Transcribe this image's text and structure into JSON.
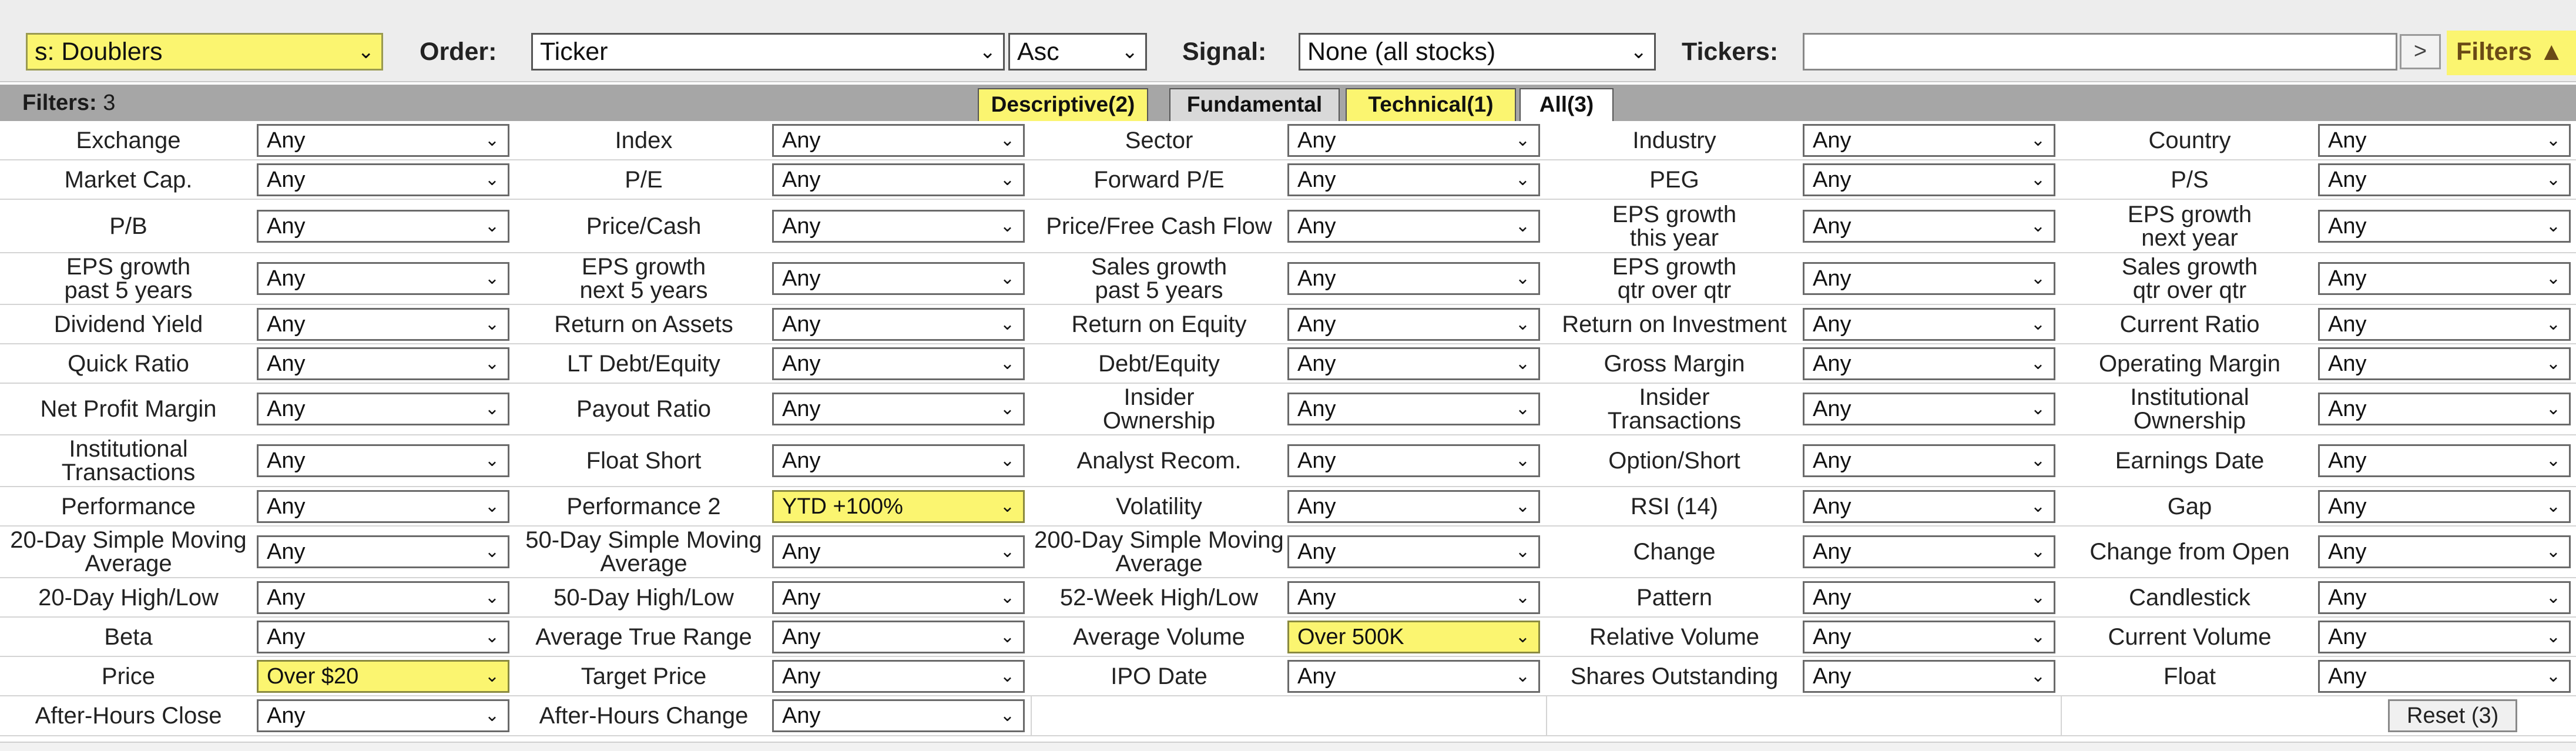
{
  "topbar": {
    "preset": "s: Doublers",
    "order_label": "Order:",
    "order_value": "Ticker",
    "order_dir": "Asc",
    "signal_label": "Signal:",
    "signal_value": "None (all stocks)",
    "tickers_label": "Tickers:",
    "tickers_value": "",
    "go_label": ">",
    "filters_toggle": "Filters ▲"
  },
  "filterbar": {
    "label": "Filters:",
    "count": "3",
    "tabs": [
      {
        "label": "Descriptive(2)",
        "state": "highlighted"
      },
      {
        "label": "Fundamental",
        "state": "normal"
      },
      {
        "label": "Technical(1)",
        "state": "highlighted"
      },
      {
        "label": "All(3)",
        "state": "active"
      }
    ]
  },
  "highlight_color": "#fbf570",
  "rows": [
    [
      {
        "label": "Exchange",
        "value": "Any"
      },
      {
        "label": "Index",
        "value": "Any"
      },
      {
        "label": "Sector",
        "value": "Any"
      },
      {
        "label": "Industry",
        "value": "Any"
      },
      {
        "label": "Country",
        "value": "Any"
      }
    ],
    [
      {
        "label": "Market Cap.",
        "value": "Any"
      },
      {
        "label": "P/E",
        "value": "Any"
      },
      {
        "label": "Forward P/E",
        "value": "Any"
      },
      {
        "label": "PEG",
        "value": "Any"
      },
      {
        "label": "P/S",
        "value": "Any"
      }
    ],
    [
      {
        "label": "P/B",
        "value": "Any"
      },
      {
        "label": "Price/Cash",
        "value": "Any"
      },
      {
        "label": "Price/Free Cash Flow",
        "value": "Any"
      },
      {
        "label": "EPS growth\nthis year",
        "value": "Any"
      },
      {
        "label": "EPS growth\nnext year",
        "value": "Any"
      }
    ],
    [
      {
        "label": "EPS growth\npast 5 years",
        "value": "Any"
      },
      {
        "label": "EPS growth\nnext 5 years",
        "value": "Any"
      },
      {
        "label": "Sales growth\npast 5 years",
        "value": "Any"
      },
      {
        "label": "EPS growth\nqtr over qtr",
        "value": "Any"
      },
      {
        "label": "Sales growth\nqtr over qtr",
        "value": "Any"
      }
    ],
    [
      {
        "label": "Dividend Yield",
        "value": "Any"
      },
      {
        "label": "Return on Assets",
        "value": "Any"
      },
      {
        "label": "Return on Equity",
        "value": "Any"
      },
      {
        "label": "Return on Investment",
        "value": "Any"
      },
      {
        "label": "Current Ratio",
        "value": "Any"
      }
    ],
    [
      {
        "label": "Quick Ratio",
        "value": "Any"
      },
      {
        "label": "LT Debt/Equity",
        "value": "Any"
      },
      {
        "label": "Debt/Equity",
        "value": "Any"
      },
      {
        "label": "Gross Margin",
        "value": "Any"
      },
      {
        "label": "Operating Margin",
        "value": "Any"
      }
    ],
    [
      {
        "label": "Net Profit Margin",
        "value": "Any"
      },
      {
        "label": "Payout Ratio",
        "value": "Any"
      },
      {
        "label": "Insider\nOwnership",
        "value": "Any"
      },
      {
        "label": "Insider\nTransactions",
        "value": "Any"
      },
      {
        "label": "Institutional\nOwnership",
        "value": "Any"
      }
    ],
    [
      {
        "label": "Institutional\nTransactions",
        "value": "Any"
      },
      {
        "label": "Float Short",
        "value": "Any"
      },
      {
        "label": "Analyst Recom.",
        "value": "Any"
      },
      {
        "label": "Option/Short",
        "value": "Any"
      },
      {
        "label": "Earnings Date",
        "value": "Any"
      }
    ],
    [
      {
        "label": "Performance",
        "value": "Any"
      },
      {
        "label": "Performance 2",
        "value": "YTD +100%",
        "hl": true
      },
      {
        "label": "Volatility",
        "value": "Any"
      },
      {
        "label": "RSI (14)",
        "value": "Any"
      },
      {
        "label": "Gap",
        "value": "Any"
      }
    ],
    [
      {
        "label": "20-Day Simple Moving\nAverage",
        "value": "Any"
      },
      {
        "label": "50-Day Simple Moving\nAverage",
        "value": "Any"
      },
      {
        "label": "200-Day Simple Moving\nAverage",
        "value": "Any"
      },
      {
        "label": "Change",
        "value": "Any"
      },
      {
        "label": "Change from Open",
        "value": "Any"
      }
    ],
    [
      {
        "label": "20-Day High/Low",
        "value": "Any"
      },
      {
        "label": "50-Day High/Low",
        "value": "Any"
      },
      {
        "label": "52-Week High/Low",
        "value": "Any"
      },
      {
        "label": "Pattern",
        "value": "Any"
      },
      {
        "label": "Candlestick",
        "value": "Any"
      }
    ],
    [
      {
        "label": "Beta",
        "value": "Any"
      },
      {
        "label": "Average True Range",
        "value": "Any"
      },
      {
        "label": "Average Volume",
        "value": "Over 500K",
        "hl": true
      },
      {
        "label": "Relative Volume",
        "value": "Any"
      },
      {
        "label": "Current Volume",
        "value": "Any"
      }
    ],
    [
      {
        "label": "Price",
        "value": "Over $20",
        "hl": true
      },
      {
        "label": "Target Price",
        "value": "Any"
      },
      {
        "label": "IPO Date",
        "value": "Any"
      },
      {
        "label": "Shares Outstanding",
        "value": "Any"
      },
      {
        "label": "Float",
        "value": "Any"
      }
    ],
    [
      {
        "label": "After-Hours Close",
        "value": "Any"
      },
      {
        "label": "After-Hours Change",
        "value": "Any"
      }
    ]
  ],
  "reset_label": "Reset (3)"
}
